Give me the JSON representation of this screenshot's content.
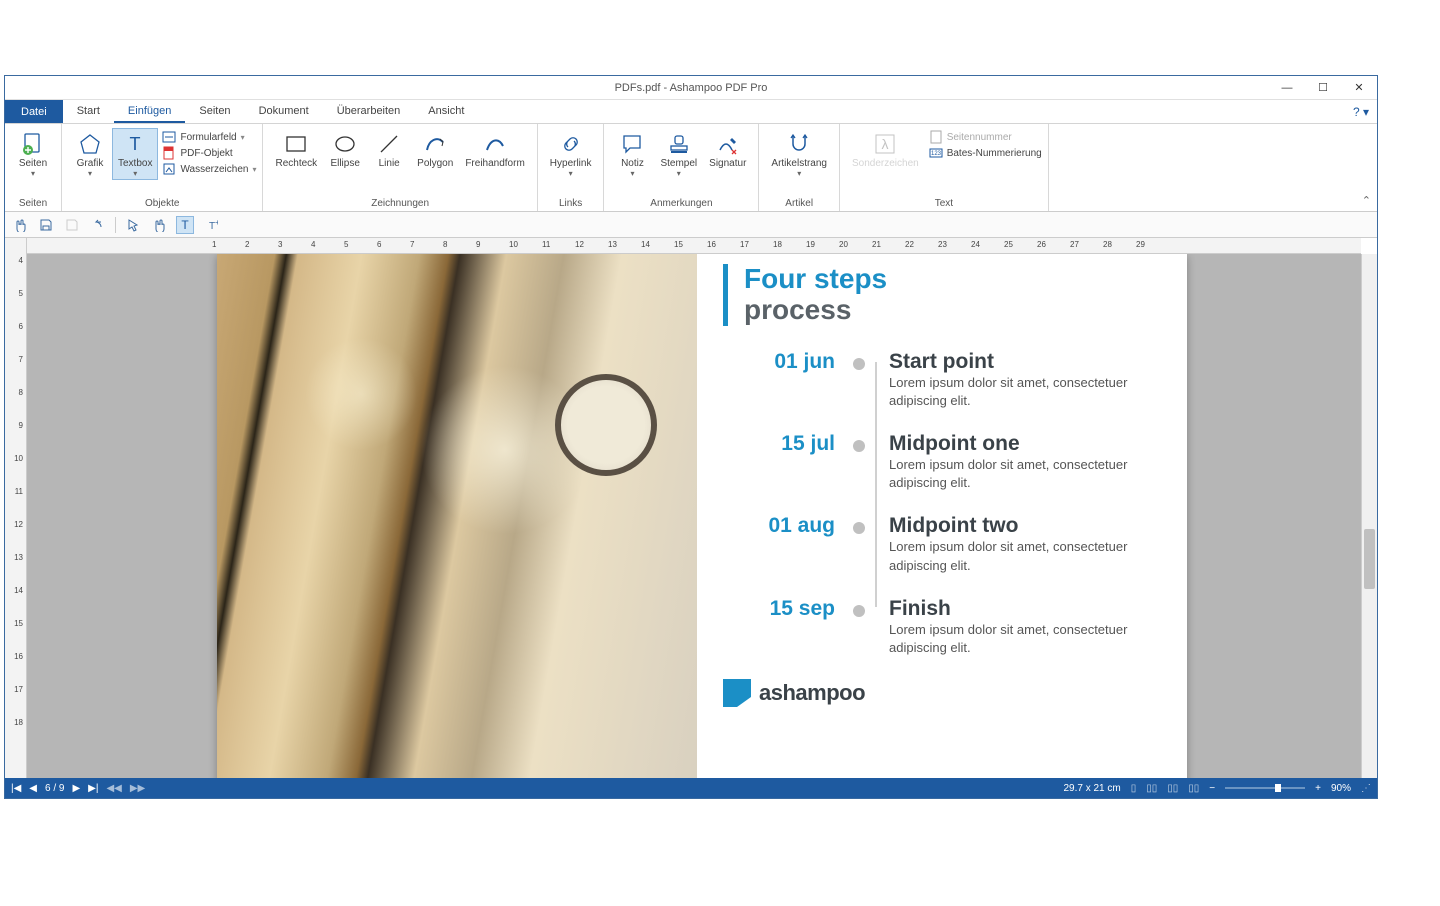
{
  "titlebar": {
    "title": "PDFs.pdf - Ashampoo PDF Pro"
  },
  "menu": {
    "file": "Datei",
    "tabs": [
      "Start",
      "Einfügen",
      "Seiten",
      "Dokument",
      "Überarbeiten",
      "Ansicht"
    ],
    "active": "Einfügen",
    "help": "?"
  },
  "ribbon": {
    "groups": {
      "seiten": {
        "label": "Seiten",
        "btn": "Seiten"
      },
      "objekte": {
        "label": "Objekte",
        "grafik": "Grafik",
        "textbox": "Textbox",
        "formularfeld": "Formularfeld",
        "pdfobjekt": "PDF-Objekt",
        "wasserzeichen": "Wasserzeichen"
      },
      "zeichnungen": {
        "label": "Zeichnungen",
        "rechteck": "Rechteck",
        "ellipse": "Ellipse",
        "linie": "Linie",
        "polygon": "Polygon",
        "freihand": "Freihandform"
      },
      "links": {
        "label": "Links",
        "hyperlink": "Hyperlink"
      },
      "anmerkungen": {
        "label": "Anmerkungen",
        "notiz": "Notiz",
        "stempel": "Stempel",
        "signatur": "Signatur"
      },
      "artikel": {
        "label": "Artikel",
        "artikelstrang": "Artikelstrang"
      },
      "text": {
        "label": "Text",
        "sonderzeichen": "Sonderzeichen",
        "seitennummer": "Seitennummer",
        "bates": "Bates-Nummerierung"
      }
    }
  },
  "ruler_h": [
    1,
    2,
    3,
    4,
    5,
    6,
    7,
    8,
    9,
    10,
    11,
    12,
    13,
    14,
    15,
    16,
    17,
    18,
    19,
    20,
    21,
    22,
    23,
    24,
    25,
    26,
    27,
    28,
    29
  ],
  "ruler_v": [
    4,
    5,
    6,
    7,
    8,
    9,
    10,
    11,
    12,
    13,
    14,
    15,
    16,
    17,
    18
  ],
  "doc": {
    "heading1": "Four steps",
    "heading2": "process",
    "steps": [
      {
        "date": "01 jun",
        "title": "Start point",
        "desc": "Lorem ipsum dolor sit amet, consectetuer adipiscing elit."
      },
      {
        "date": "15 jul",
        "title": "Midpoint one",
        "desc": "Lorem ipsum dolor sit amet, consectetuer adipiscing elit."
      },
      {
        "date": "01 aug",
        "title": "Midpoint two",
        "desc": "Lorem ipsum dolor sit amet, consectetuer adipiscing elit."
      },
      {
        "date": "15 sep",
        "title": "Finish",
        "desc": "Lorem ipsum dolor sit amet, consectetuer adipiscing elit."
      }
    ],
    "brand": "ashampoo"
  },
  "status": {
    "page": "6 / 9",
    "dims": "29.7 x 21 cm",
    "zoom": "90%"
  }
}
